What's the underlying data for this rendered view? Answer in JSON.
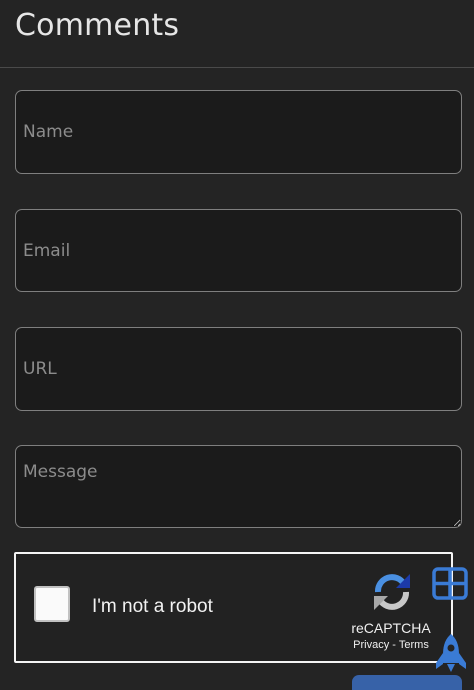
{
  "header": {
    "title": "Comments"
  },
  "form": {
    "name": {
      "value": "",
      "placeholder": "Name"
    },
    "email": {
      "value": "",
      "placeholder": "Email"
    },
    "url": {
      "value": "",
      "placeholder": "URL"
    },
    "message": {
      "value": "",
      "placeholder": "Message"
    },
    "submit_label": ""
  },
  "recaptcha": {
    "checked": false,
    "label": "I'm not a robot",
    "brand": "reCAPTCHA",
    "privacy": "Privacy",
    "separator": "-",
    "terms": "Terms"
  },
  "icons": {
    "recaptcha_logo": "recaptcha-logo-icon",
    "table": "table-icon",
    "rocket": "rocket-icon"
  },
  "colors": {
    "background": "#242424",
    "field_background": "#1b1b1b",
    "field_border": "#7f7f7f",
    "accent": "#3a7bd5",
    "submit": "#3762a8"
  }
}
